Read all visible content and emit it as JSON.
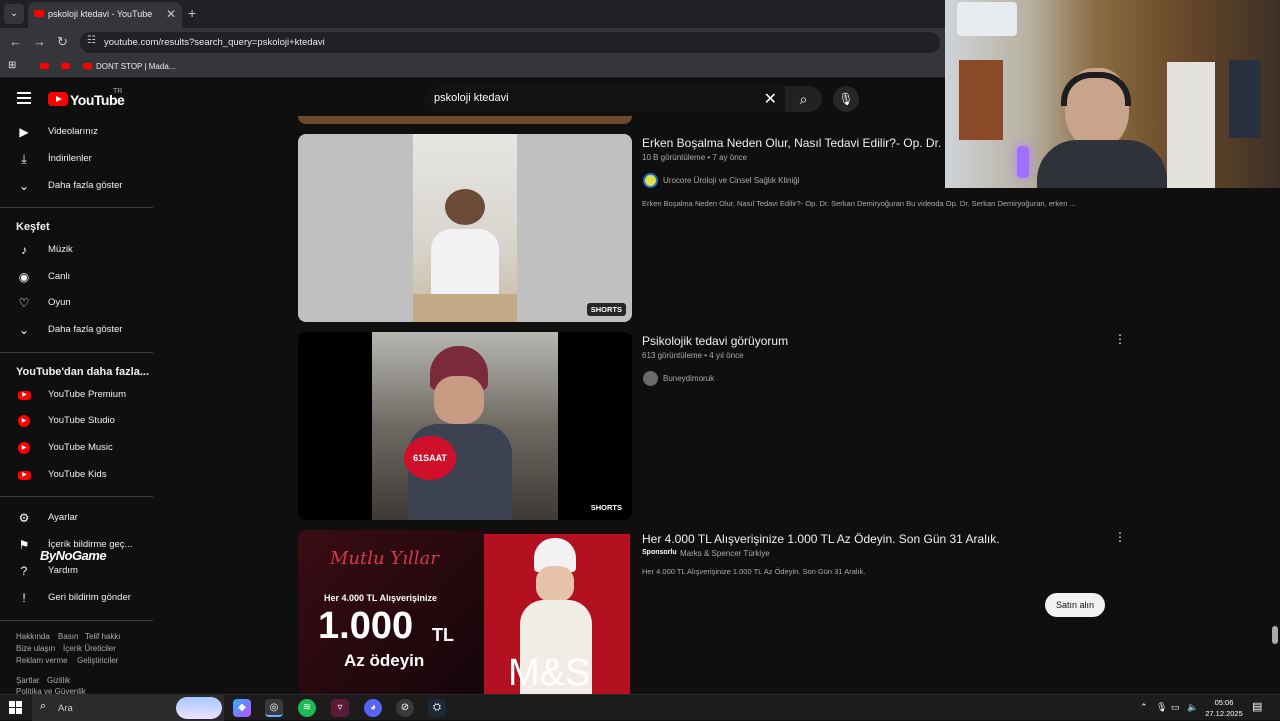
{
  "browser": {
    "tab_title": "pskoloji ktedavi - YouTube",
    "url": "youtube.com/results?search_query=pskoloji+ktedavi",
    "bookmarks": [
      {
        "label": ""
      },
      {
        "label": ""
      },
      {
        "label": "DONT STOP | Mada..."
      }
    ]
  },
  "header": {
    "logo_text": "YouTube",
    "country": "TR",
    "search_value": "pskoloji ktedavi"
  },
  "sidebar": {
    "top_items": [
      {
        "label": "Videolarınız",
        "icon": "video-icon"
      },
      {
        "label": "İndirilenler",
        "icon": "download-icon"
      },
      {
        "label": "Daha fazla göster",
        "icon": "chevron-down-icon"
      }
    ],
    "explore_heading": "Keşfet",
    "explore_items": [
      {
        "label": "Müzik",
        "icon": "music-icon"
      },
      {
        "label": "Canlı",
        "icon": "live-icon"
      },
      {
        "label": "Oyun",
        "icon": "gaming-icon"
      },
      {
        "label": "Daha fazla göster",
        "icon": "chevron-down-icon"
      }
    ],
    "more_heading": "YouTube'dan daha fazla...",
    "more_items": [
      {
        "label": "YouTube Premium"
      },
      {
        "label": "YouTube Studio"
      },
      {
        "label": "YouTube Music"
      },
      {
        "label": "YouTube Kids"
      }
    ],
    "settings_items": [
      {
        "label": "Ayarlar",
        "icon": "gear-icon"
      },
      {
        "label": "İçerik bildirme geç...",
        "icon": "flag-icon"
      },
      {
        "label": "Yardım",
        "icon": "help-icon"
      },
      {
        "label": "Geri bildirim gönder",
        "icon": "feedback-icon"
      }
    ],
    "footer_row1": [
      "Hakkında",
      "Basın",
      "Telif hakkı"
    ],
    "footer_row2": [
      "Bize ulaşın",
      "İçerik Üreticiler"
    ],
    "footer_row3": [
      "Reklam verme",
      "Geliştiriciler"
    ],
    "footer_row4": [
      "Şartlar",
      "Gizlilik"
    ],
    "footer_row5": [
      "Politika ve Güvenlik"
    ],
    "watermark": "ByNoGame"
  },
  "results": [
    {
      "title": "Erken Boşalma Neden Olur, Nasıl Tedavi Edilir?- Op. Dr. Se",
      "meta": "10 B görüntüleme • 7 ay önce",
      "channel": "Urocore Üroloji ve Cinsel Sağlık Kliniği",
      "description": "Erken Boşalma Neden Olur, Nasıl Tedavi Edilir?- Op. Dr. Serkan Demiryoğuran Bu videoda Op. Dr. Serkan Demiryoğuran, erken ...",
      "badge": "SHORTS"
    },
    {
      "title": "Psikolojik tedavi görüyorum",
      "meta": "613 görüntüleme • 4 yıl önce",
      "channel": "Buneydimoruk",
      "description": "",
      "badge": "SHORTS",
      "mic_logo": "61SAAT"
    },
    {
      "title": "Her 4.000 TL Alışverişinize 1.000 TL Az Ödeyin. Son Gün 31 Aralık.",
      "sponsor": "Sponsorlu",
      "channel": "Marks & Spencer Türkiye",
      "description": "Her 4.000 TL Alışverişinize 1.000 TL Az Ödeyin. Son Gün 31 Aralık.",
      "cta": "Satın alın",
      "ad_script": "Mutlu Yıllar",
      "ad_line1": "Her 4.000 TL Alışverişinize",
      "ad_big": "1.000",
      "ad_tl": "TL",
      "ad_line2": "Az ödeyin",
      "ad_brand": "M&S"
    }
  ],
  "taskbar": {
    "search_label": "Ara",
    "time": "05:06",
    "date": "27.12.2025"
  }
}
